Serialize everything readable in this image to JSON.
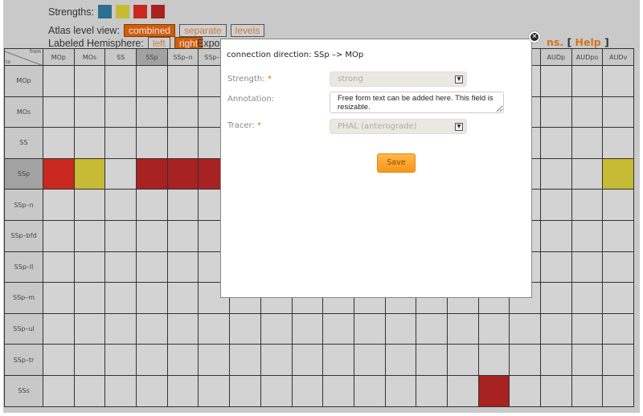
{
  "strengths": {
    "label": "Strengths:",
    "colors": [
      "#2e6e90",
      "#c6bb34",
      "#c8281e",
      "#a82222"
    ]
  },
  "atlas": {
    "label": "Atlas level view:",
    "options": [
      "combined",
      "separate",
      "levels"
    ],
    "active": "combined"
  },
  "hemisphere": {
    "label": "Labeled Hemisphere:",
    "options": [
      "left",
      "right"
    ],
    "active": "right"
  },
  "export_label": "Expo",
  "help": {
    "suffix": "ns.",
    "open": "[",
    "label": "Help",
    "close": "]"
  },
  "grid": {
    "corner": {
      "from": "from",
      "to": "to"
    },
    "columns": [
      "MOp",
      "MOs",
      "SS",
      "SSp",
      "SSp–n",
      "SSp–b",
      "",
      "",
      "",
      "",
      "",
      "",
      "",
      "",
      "",
      "",
      "AUDp",
      "AUDpo",
      "AUDv"
    ],
    "selected_column": 3,
    "rows": [
      "MOp",
      "MOs",
      "SS",
      "SSp",
      "SSp–n",
      "SSp–bfd",
      "SSp–ll",
      "SSp–m",
      "SSp–ul",
      "SSp–tr",
      "SSs"
    ],
    "selected_row": 3,
    "filled_cells": [
      {
        "row": 3,
        "col": 0,
        "color": "#c8281e"
      },
      {
        "row": 3,
        "col": 1,
        "color": "#c6bb34"
      },
      {
        "row": 3,
        "col": 3,
        "color": "#a82222"
      },
      {
        "row": 3,
        "col": 4,
        "color": "#a82222"
      },
      {
        "row": 3,
        "col": 5,
        "color": "#a82222"
      },
      {
        "row": 3,
        "col": 18,
        "color": "#c6bb34"
      },
      {
        "row": 10,
        "col": 14,
        "color": "#a82222"
      }
    ]
  },
  "modal": {
    "title": "connection direction: SSp –> MOp",
    "strength_label": "Strength:",
    "strength_value": "strong",
    "annotation_label": "Annotation:",
    "annotation_value": "Free form text can be added here. This field is resizable.",
    "tracer_label": "Tracer:",
    "tracer_value": "PHAL (anterograde)",
    "required_mark": "*",
    "save_label": "Save"
  }
}
